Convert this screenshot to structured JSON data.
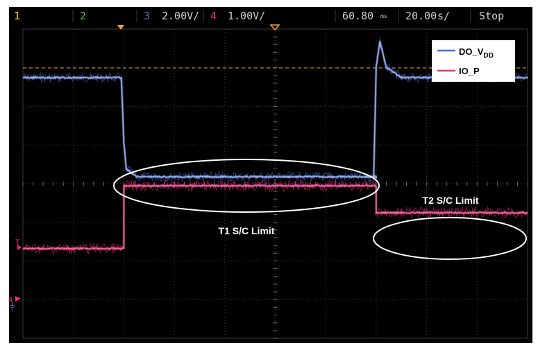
{
  "status_bar": {
    "ch1_label": "1",
    "ch2_label": "2",
    "ch3_label": "3",
    "ch3_scale": "2.00V/",
    "ch4_label": "4",
    "ch4_scale": "1.00V/",
    "time_offset": "60.80",
    "time_offset_unit": "ms",
    "time_scale": "20.00",
    "time_scale_unit": "s/",
    "run_state": "Stop"
  },
  "colors": {
    "ch1": "#f0e03a",
    "ch2": "#4fbf4f",
    "ch3": "#4a6fd0",
    "ch4": "#e8307a",
    "trigger": "#f0a030",
    "grid": "#555555",
    "annotation": "#ffffff",
    "background": "#000000"
  },
  "markers": {
    "trigger_label": "T",
    "ch4_ground_label": "4"
  },
  "chart_data": {
    "type": "line",
    "title": "",
    "xlabel": "",
    "ylabel": "",
    "grid": true,
    "x_unit": "ms",
    "x_divisions": 10,
    "xlim": [
      0,
      200
    ],
    "legend": {
      "placement": "top-right",
      "entries": [
        "DO_VDD",
        "IO_P"
      ]
    },
    "series": [
      {
        "name": "DO_VDD",
        "color": "#4a6fd0",
        "points": [
          [
            0,
            4.6
          ],
          [
            39,
            4.6
          ],
          [
            40,
            2.1
          ],
          [
            41,
            1.1
          ],
          [
            45,
            0.8
          ],
          [
            80,
            0.8
          ],
          [
            140,
            0.8
          ],
          [
            139,
            0.8
          ],
          [
            140,
            5.0
          ],
          [
            141.5,
            6.0
          ],
          [
            144,
            5.0
          ],
          [
            150,
            4.6
          ],
          [
            200,
            4.6
          ]
        ]
      },
      {
        "name": "IO_P",
        "color": "#e8307a",
        "points": [
          [
            0,
            -3.25
          ],
          [
            39,
            -3.25
          ],
          [
            40,
            -3.25
          ],
          [
            40,
            0
          ],
          [
            140,
            0
          ],
          [
            140,
            -1.4
          ],
          [
            200,
            -1.4
          ]
        ]
      }
    ],
    "annotations": [
      {
        "text": "T1 S/C Limit",
        "target": "IO_P",
        "x_range": [
          40,
          140
        ]
      },
      {
        "text": "T2 S/C Limit",
        "target": "IO_P",
        "x_range": [
          140,
          200
        ]
      }
    ],
    "legend_labels": {
      "DO_VDD_main": "DO_V",
      "DO_VDD_sub": "DD",
      "IO_P": "IO_P"
    }
  }
}
